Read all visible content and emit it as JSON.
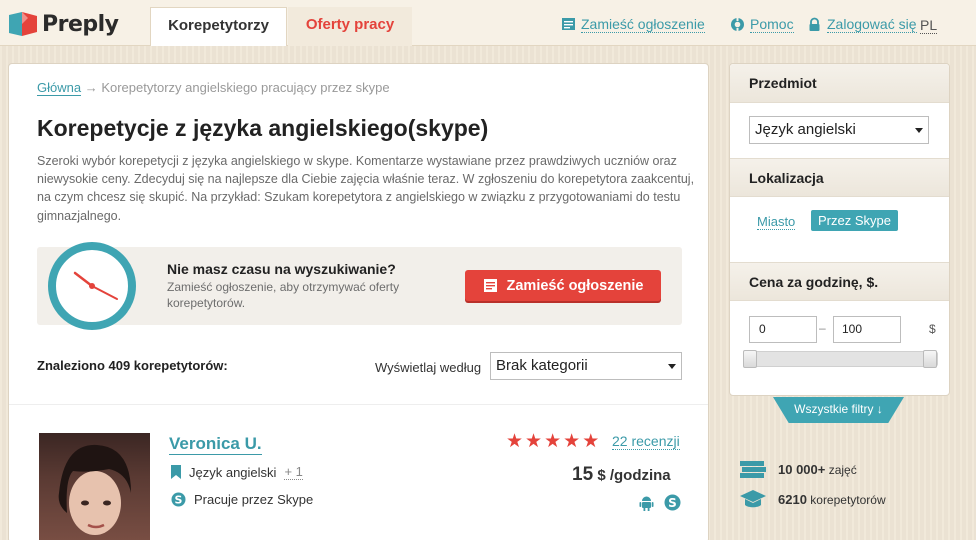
{
  "header": {
    "logo_text": "Preply",
    "tabs": [
      {
        "label": "Korepetytorzy"
      },
      {
        "label": "Oferty pracy"
      }
    ],
    "links": {
      "post_ad": "Zamieść ogłoszenie",
      "help": "Pomoc",
      "login": "Zalogować się",
      "lang": "PL"
    }
  },
  "breadcrumb": {
    "home": "Główna",
    "arrow": "→",
    "current": "Korepetytorzy angielskiego pracujący przez skype"
  },
  "page": {
    "title": "Korepetycje z języka angielskiego(skype)",
    "description": "Szeroki wybór korepetycji z języka angielskiego w skype. Komentarze wystawiane przez prawdziwych uczniów oraz niewysokie ceny. Zdecyduj się na najlepsze dla Ciebie zajęcia właśnie teraz. W zgłoszeniu do korepetytora zaakcentuj, na czym chcesz się skupić. Na przykład: Szukam korepetytora z angielskiego w związku z przygotowaniami do testu gimnazjalnego."
  },
  "promo": {
    "title": "Nie masz czasu na wyszukiwanie?",
    "text": "Zamieść ogłoszenie, aby otrzymywać oferty korepetytorów.",
    "button": "Zamieść ogłoszenie"
  },
  "results": {
    "found": "Znaleziono 409 korepetytorów:",
    "sort_label": "Wyświetlaj według",
    "sort_value": "Brak kategorii"
  },
  "tutor": {
    "name": "Veronica U.",
    "language": "Język angielski",
    "more": "+ 1",
    "skype": "Pracuje przez Skype",
    "stars": 5,
    "reviews": "22 recenzji",
    "price_amount": "15",
    "price_unit": "$ /godzina"
  },
  "sidebar": {
    "subject_head": "Przedmiot",
    "subject_value": "Język angielski",
    "location_head": "Lokalizacja",
    "location_city": "Miasto",
    "location_skype": "Przez Skype",
    "price_head": "Cena za godzinę, $.",
    "price_from": "0",
    "price_dash": "–",
    "price_to": "100",
    "currency": "$",
    "range": [
      0,
      100
    ],
    "all_filters": "Wszystkie filtry ↓"
  },
  "stats": [
    {
      "value": "10 000+",
      "label": "zajęć"
    },
    {
      "value": "6210",
      "label": "korepetytorów"
    }
  ],
  "colors": {
    "accent_teal": "#3b9aa8",
    "accent_red": "#e4433b"
  }
}
